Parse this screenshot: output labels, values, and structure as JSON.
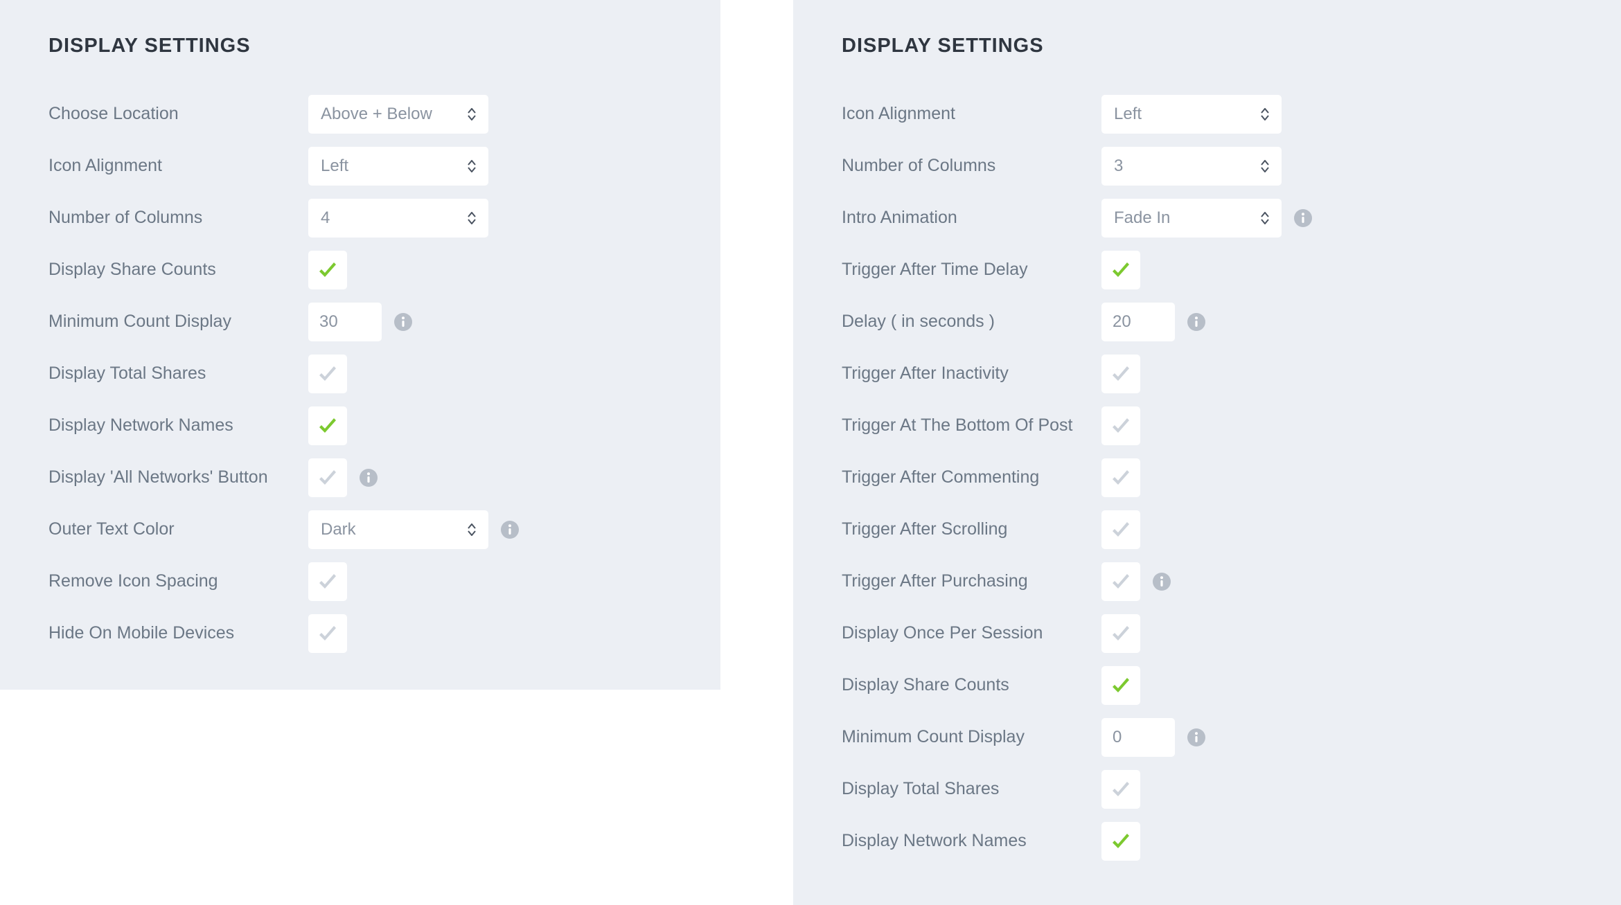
{
  "left": {
    "title": "DISPLAY SETTINGS",
    "rows": [
      {
        "label": "Choose Location",
        "type": "select",
        "value": "Above + Below"
      },
      {
        "label": "Icon Alignment",
        "type": "select",
        "value": "Left"
      },
      {
        "label": "Number of Columns",
        "type": "select",
        "value": "4"
      },
      {
        "label": "Display Share Counts",
        "type": "checkbox",
        "checked": true
      },
      {
        "label": "Minimum Count Display",
        "type": "text",
        "value": "30",
        "info": true
      },
      {
        "label": "Display Total Shares",
        "type": "checkbox",
        "checked": false
      },
      {
        "label": "Display Network Names",
        "type": "checkbox",
        "checked": true
      },
      {
        "label": "Display 'All Networks' Button",
        "type": "checkbox",
        "checked": false,
        "info": true
      },
      {
        "label": "Outer Text Color",
        "type": "select",
        "value": "Dark",
        "info": true
      },
      {
        "label": "Remove Icon Spacing",
        "type": "checkbox",
        "checked": false
      },
      {
        "label": "Hide On Mobile Devices",
        "type": "checkbox",
        "checked": false
      }
    ]
  },
  "right": {
    "title": "DISPLAY SETTINGS",
    "rows": [
      {
        "label": "Icon Alignment",
        "type": "select",
        "value": "Left"
      },
      {
        "label": "Number of Columns",
        "type": "select",
        "value": "3"
      },
      {
        "label": "Intro Animation",
        "type": "select",
        "value": "Fade In",
        "info": true
      },
      {
        "label": "Trigger After Time Delay",
        "type": "checkbox",
        "checked": true
      },
      {
        "label": "Delay ( in seconds )",
        "type": "text",
        "value": "20",
        "info": true
      },
      {
        "label": "Trigger After Inactivity",
        "type": "checkbox",
        "checked": false
      },
      {
        "label": "Trigger At The Bottom Of Post",
        "type": "checkbox",
        "checked": false
      },
      {
        "label": "Trigger After Commenting",
        "type": "checkbox",
        "checked": false
      },
      {
        "label": "Trigger After Scrolling",
        "type": "checkbox",
        "checked": false
      },
      {
        "label": "Trigger After Purchasing",
        "type": "checkbox",
        "checked": false,
        "info": true
      },
      {
        "label": "Display Once Per Session",
        "type": "checkbox",
        "checked": false
      },
      {
        "label": "Display Share Counts",
        "type": "checkbox",
        "checked": true
      },
      {
        "label": "Minimum Count Display",
        "type": "text",
        "value": "0",
        "info": true
      },
      {
        "label": "Display Total Shares",
        "type": "checkbox",
        "checked": false
      },
      {
        "label": "Display Network Names",
        "type": "checkbox",
        "checked": true
      }
    ]
  }
}
